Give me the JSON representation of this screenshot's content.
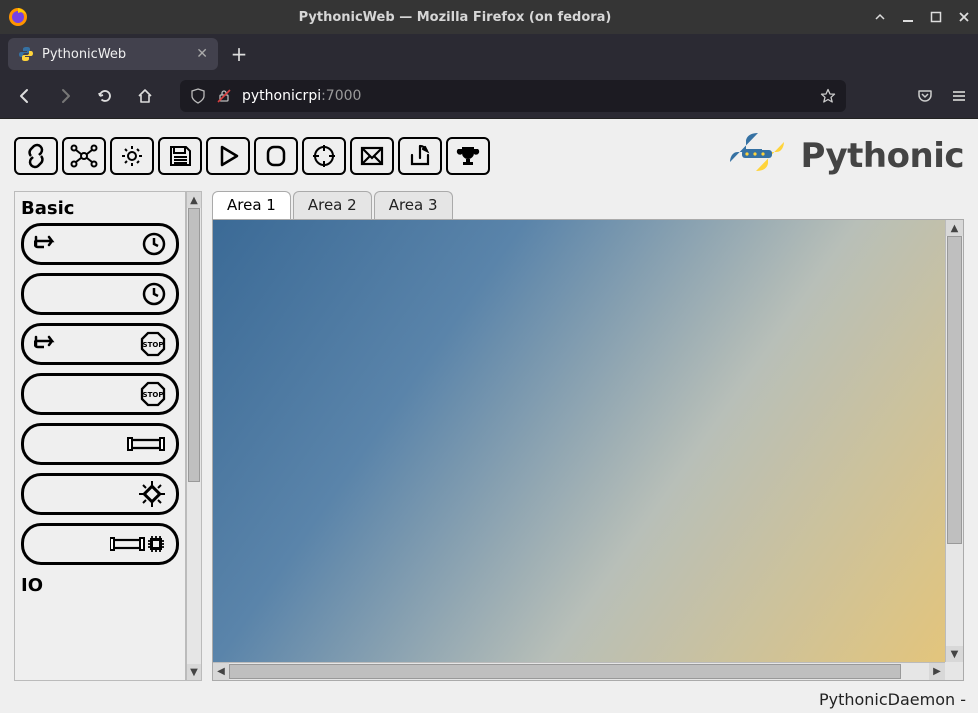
{
  "window": {
    "title": "PythonicWeb — Mozilla Firefox (on fedora)"
  },
  "browser": {
    "tab_title": "PythonicWeb",
    "url_host": "pythonicrpi",
    "url_port": ":7000"
  },
  "brand": {
    "name": "Pythonic"
  },
  "toolbar_buttons": [
    {
      "id": "link",
      "name": "link-icon"
    },
    {
      "id": "network",
      "name": "network-icon"
    },
    {
      "id": "settings",
      "name": "gear-icon"
    },
    {
      "id": "save",
      "name": "save-icon"
    },
    {
      "id": "play",
      "name": "play-icon"
    },
    {
      "id": "stop",
      "name": "stop-shape-icon"
    },
    {
      "id": "target",
      "name": "crosshair-icon"
    },
    {
      "id": "mail",
      "name": "mail-icon"
    },
    {
      "id": "export",
      "name": "export-icon"
    },
    {
      "id": "trophy",
      "name": "trophy-icon"
    }
  ],
  "palette": {
    "categories": [
      {
        "label": "Basic"
      },
      {
        "label": "IO"
      }
    ],
    "items": [
      {
        "left": "hand",
        "right": "clock",
        "name": "scheduler-element"
      },
      {
        "left": "",
        "right": "clock",
        "name": "clock-element"
      },
      {
        "left": "hand",
        "right": "stop",
        "name": "manual-stop-element"
      },
      {
        "left": "",
        "right": "stop",
        "name": "stop-element"
      },
      {
        "left": "",
        "right": "pipe",
        "name": "pipe-element"
      },
      {
        "left": "",
        "right": "chip",
        "name": "process-element"
      },
      {
        "left": "",
        "right": "pipechip",
        "name": "pipe-process-element"
      }
    ]
  },
  "workspace": {
    "tabs": [
      {
        "label": "Area 1",
        "active": true
      },
      {
        "label": "Area 2",
        "active": false
      },
      {
        "label": "Area 3",
        "active": false
      }
    ]
  },
  "status": {
    "text": "PythonicDaemon -"
  }
}
